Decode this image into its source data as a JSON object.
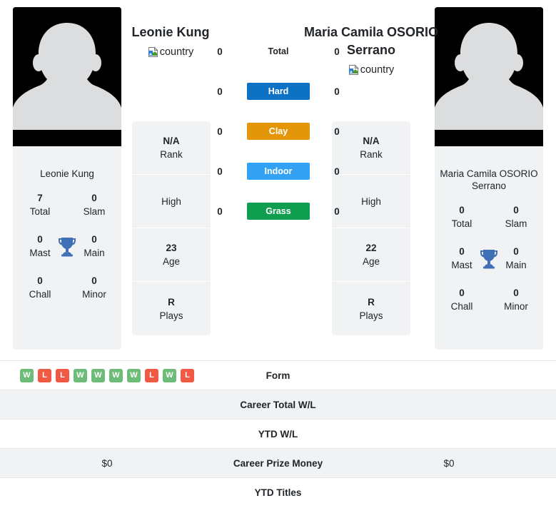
{
  "players": {
    "left": {
      "name": "Leonie Kung",
      "avatar_name": "Leonie Kung",
      "flag_alt": "country",
      "titles": [
        {
          "value": "7",
          "label": "Total"
        },
        {
          "value": "0",
          "label": "Slam"
        },
        {
          "value": "0",
          "label": "Mast"
        },
        {
          "value": "0",
          "label": "Main"
        },
        {
          "value": "0",
          "label": "Chall"
        },
        {
          "value": "0",
          "label": "Minor"
        }
      ],
      "info": [
        {
          "value": "N/A",
          "label": "Rank"
        },
        {
          "value": "",
          "label": "High"
        },
        {
          "value": "23",
          "label": "Age"
        },
        {
          "value": "R",
          "label": "Plays"
        }
      ],
      "surface_counts": {
        "total": "0",
        "hard": "0",
        "clay": "0",
        "indoor": "0",
        "grass": "0"
      },
      "career_total_wl": "",
      "ytd_wl": "",
      "career_prize_money": "$0",
      "ytd_titles": ""
    },
    "right": {
      "name": "Maria Camila OSORIO Serrano",
      "avatar_name": "Maria Camila OSORIO Serrano",
      "flag_alt": "country",
      "titles": [
        {
          "value": "0",
          "label": "Total"
        },
        {
          "value": "0",
          "label": "Slam"
        },
        {
          "value": "0",
          "label": "Mast"
        },
        {
          "value": "0",
          "label": "Main"
        },
        {
          "value": "0",
          "label": "Chall"
        },
        {
          "value": "0",
          "label": "Minor"
        }
      ],
      "info": [
        {
          "value": "N/A",
          "label": "Rank"
        },
        {
          "value": "",
          "label": "High"
        },
        {
          "value": "22",
          "label": "Age"
        },
        {
          "value": "R",
          "label": "Plays"
        }
      ],
      "surface_counts": {
        "total": "0",
        "hard": "0",
        "clay": "0",
        "indoor": "0",
        "grass": "0"
      },
      "career_total_wl": "",
      "ytd_wl": "",
      "career_prize_money": "$0",
      "ytd_titles": ""
    }
  },
  "surfaces": [
    {
      "key": "total",
      "label": "Total",
      "color": "transparent"
    },
    {
      "key": "hard",
      "label": "Hard",
      "color": "#0e72c4"
    },
    {
      "key": "clay",
      "label": "Clay",
      "color": "#e39609"
    },
    {
      "key": "indoor",
      "label": "Indoor",
      "color": "#33a2f2"
    },
    {
      "key": "grass",
      "label": "Grass",
      "color": "#0f9d4f"
    }
  ],
  "form": {
    "label": "Form",
    "results": [
      "W",
      "L",
      "L",
      "W",
      "W",
      "W",
      "W",
      "L",
      "W",
      "L"
    ],
    "win_color": "#6dbd79",
    "loss_color": "#f05a44"
  },
  "comparison_rows": [
    {
      "key": "form",
      "label": "Form"
    },
    {
      "key": "career_total_wl",
      "label": "Career Total W/L"
    },
    {
      "key": "ytd_wl",
      "label": "YTD W/L"
    },
    {
      "key": "career_prize_money",
      "label": "Career Prize Money"
    },
    {
      "key": "ytd_titles",
      "label": "YTD Titles"
    }
  ],
  "theme": {
    "panel_bg": "#f1f2f3",
    "trophy_color": "#3f6fb5",
    "avatar_bg": "#000000",
    "avatar_silhouette": "#dcdddf"
  }
}
